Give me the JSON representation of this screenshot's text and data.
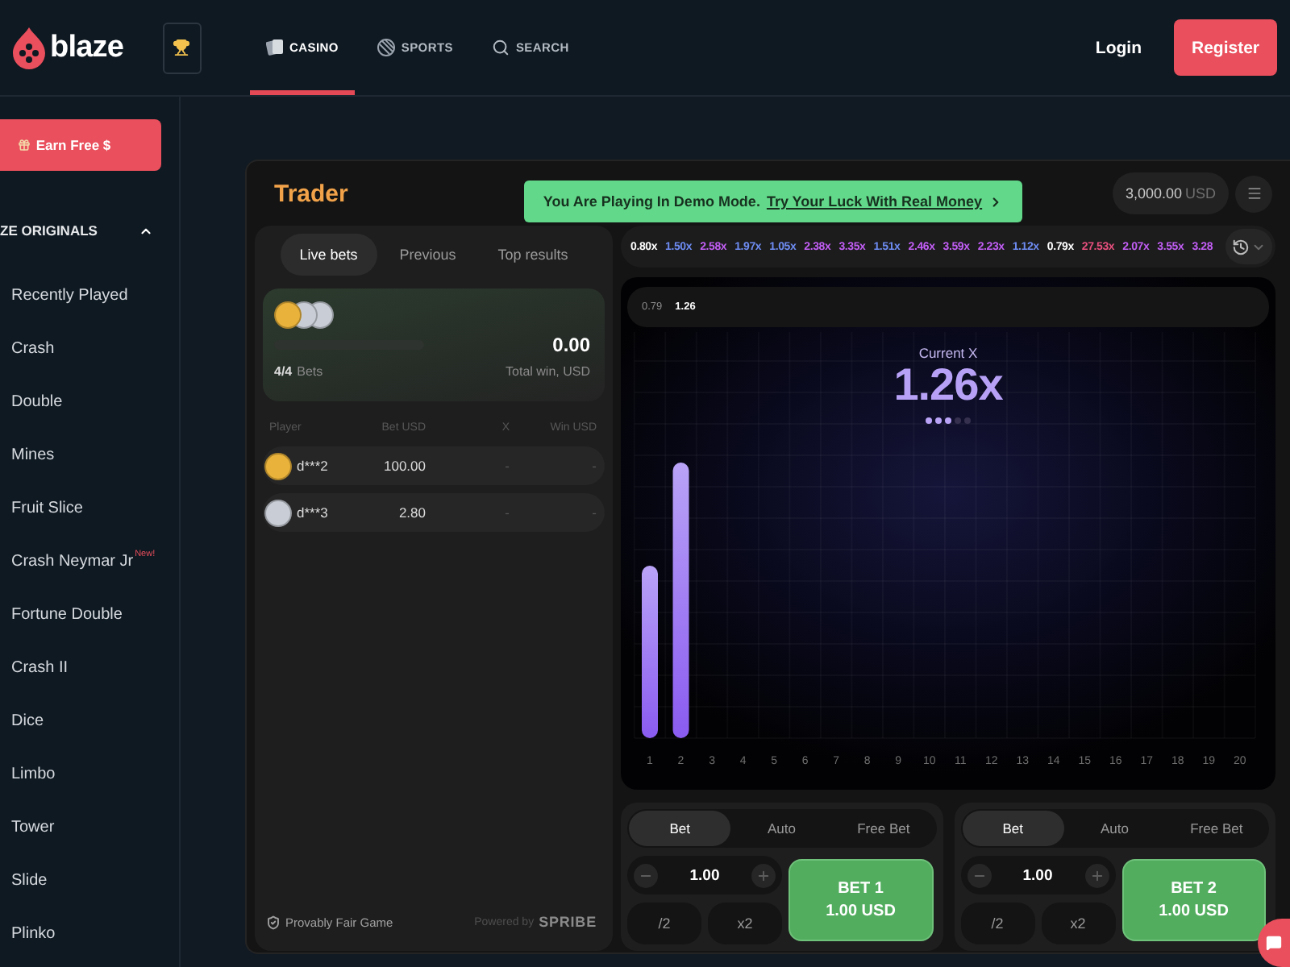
{
  "header": {
    "logo": "blaze",
    "nav": [
      {
        "label": "CASINO",
        "selected": true
      },
      {
        "label": "SPORTS",
        "selected": false
      },
      {
        "label": "SEARCH",
        "selected": false
      }
    ],
    "login": "Login",
    "register": "Register"
  },
  "sidebar": {
    "earn_button": "Earn Free $",
    "section": {
      "title": "ZE ORIGINALS",
      "expanded": true
    },
    "items": [
      {
        "label": "Recently Played"
      },
      {
        "label": "Crash"
      },
      {
        "label": "Double"
      },
      {
        "label": "Mines"
      },
      {
        "label": "Fruit Slice"
      },
      {
        "label": "Crash Neymar Jr",
        "badge": "New!"
      },
      {
        "label": "Fortune Double"
      },
      {
        "label": "Crash II"
      },
      {
        "label": "Dice"
      },
      {
        "label": "Limbo"
      },
      {
        "label": "Tower"
      },
      {
        "label": "Slide"
      },
      {
        "label": "Plinko"
      }
    ]
  },
  "game": {
    "title": "Trader",
    "demo_banner": {
      "text": "You Are Playing In Demo Mode.",
      "link": "Try Your Luck With Real Money"
    },
    "balance": {
      "amount": "3,000.00",
      "currency": "USD"
    },
    "bets_panel": {
      "tabs": [
        {
          "label": "Live bets",
          "selected": true
        },
        {
          "label": "Previous",
          "selected": false
        },
        {
          "label": "Top results",
          "selected": false
        }
      ],
      "summary": {
        "avatars": [
          {
            "color": "#e9b23a"
          },
          {
            "color": "#c9ced6"
          },
          {
            "color": "#c9ced6"
          }
        ],
        "total": "0.00",
        "bets_count": "4/4",
        "bets_label": "Bets",
        "total_label": "Total win, USD"
      },
      "columns": [
        "Player",
        "Bet USD",
        "X",
        "Win USD"
      ],
      "rows": [
        {
          "player": "d***2",
          "bet": "100.00",
          "x": "-",
          "win": "-",
          "color": "#e9b23a"
        },
        {
          "player": "d***3",
          "bet": "2.80",
          "x": "-",
          "win": "-",
          "color": "#c9ced6"
        }
      ],
      "footer": {
        "fair": "Provably Fair Game",
        "powered_by": "Powered by",
        "provider": "SPRIBE"
      }
    },
    "history": [
      {
        "value": "0.80x",
        "color": "#ffffff"
      },
      {
        "value": "1.50x",
        "color": "#6e8cf2"
      },
      {
        "value": "2.58x",
        "color": "#c25ef5"
      },
      {
        "value": "1.97x",
        "color": "#6e8cf2"
      },
      {
        "value": "1.05x",
        "color": "#6e8cf2"
      },
      {
        "value": "2.38x",
        "color": "#c25ef5"
      },
      {
        "value": "3.35x",
        "color": "#c25ef5"
      },
      {
        "value": "1.51x",
        "color": "#6e8cf2"
      },
      {
        "value": "2.46x",
        "color": "#c25ef5"
      },
      {
        "value": "3.59x",
        "color": "#c25ef5"
      },
      {
        "value": "2.23x",
        "color": "#c25ef5"
      },
      {
        "value": "1.12x",
        "color": "#6e8cf2"
      },
      {
        "value": "0.79x",
        "color": "#ffffff"
      },
      {
        "value": "27.53x",
        "color": "#e8507f"
      },
      {
        "value": "2.07x",
        "color": "#c25ef5"
      },
      {
        "value": "3.55x",
        "color": "#c25ef5"
      },
      {
        "value": "3.28",
        "color": "#c25ef5"
      }
    ],
    "chart": {
      "rounds": [
        {
          "value": "0.79",
          "current": false
        },
        {
          "value": "1.26",
          "current": true
        }
      ],
      "current_label": "Current X",
      "current_value": "1.26x",
      "dots": [
        {
          "lit": true
        },
        {
          "lit": true
        },
        {
          "lit": true
        },
        {
          "lit": false
        },
        {
          "lit": false
        }
      ],
      "step_labels": [
        "1",
        "2",
        "3",
        "4",
        "5",
        "6",
        "7",
        "8",
        "9",
        "10",
        "11",
        "12",
        "13",
        "14",
        "15",
        "16",
        "17",
        "18",
        "19",
        "20"
      ]
    },
    "bet_panels": [
      {
        "tabs": [
          {
            "label": "Bet",
            "selected": true
          },
          {
            "label": "Auto",
            "selected": false
          },
          {
            "label": "Free Bet",
            "selected": false
          }
        ],
        "amount": "1.00",
        "halve": "/2",
        "double": "x2",
        "button": {
          "title": "BET 1",
          "amount": "1.00 USD"
        }
      },
      {
        "tabs": [
          {
            "label": "Bet",
            "selected": true
          },
          {
            "label": "Auto",
            "selected": false
          },
          {
            "label": "Free Bet",
            "selected": false
          }
        ],
        "amount": "1.00",
        "halve": "/2",
        "double": "x2",
        "button": {
          "title": "BET 2",
          "amount": "1.00 USD"
        }
      }
    ]
  }
}
